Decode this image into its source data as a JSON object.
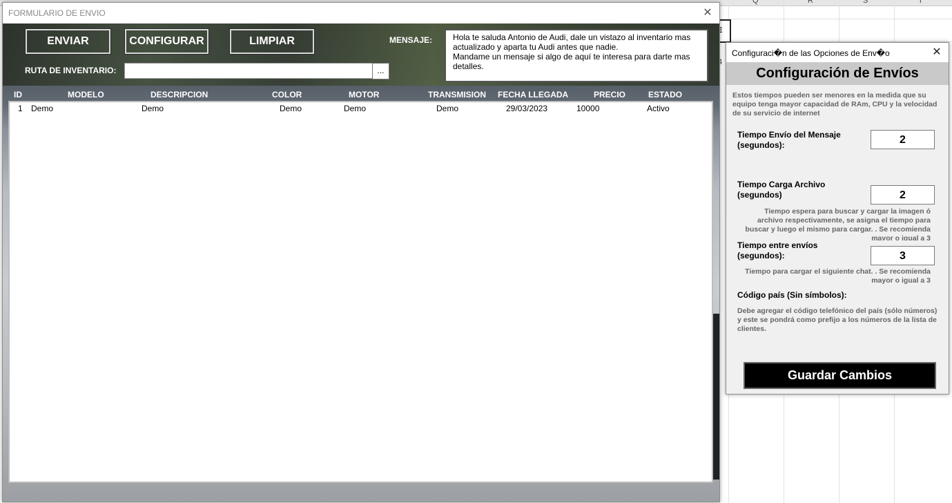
{
  "main_form": {
    "title": "FORMULARIO DE ENVIO",
    "close_glyph": "✕",
    "buttons": {
      "send": "ENVIAR",
      "configure": "CONFIGURAR",
      "clear": "LIMPIAR"
    },
    "message_label": "MENSAJE:",
    "message_text": "Hola te saluda Antonio de Audi, dale un vistazo al inventario mas actualizado y aparta tu Audi antes que nadie.\nMandame un mensaje si algo de aquí te interesa para darte mas detalles.",
    "inventory_path_label": "RUTA DE INVENTARIO:",
    "inventory_path_value": "",
    "browse_label": "...",
    "table": {
      "headers": [
        "ID",
        "MODELO",
        "DESCRIPCION",
        "COLOR",
        "MOTOR",
        "TRANSMISION",
        "FECHA LLEGADA",
        "PRECIO",
        "ESTADO"
      ],
      "rows": [
        [
          "1",
          "Demo",
          "Demo",
          "Demo",
          "Demo",
          "Demo",
          "29/03/2023",
          "10000",
          "Activo"
        ]
      ]
    }
  },
  "config_window": {
    "title": "Configuraci�n de las Opciones de Env�o",
    "close_glyph": "✕",
    "heading": "Configuración de Envíos",
    "intro_note": "Estos tiempos pueden ser menores en la medida que su equipo tenga mayor capacidad de RAm, CPU y la velocidad de su servicio de internet",
    "fields": {
      "message_time": {
        "label": "Tiempo Envío del Mensaje (segundos):",
        "value": "2"
      },
      "file_load_time": {
        "label": "Tiempo Carga Archivo (segundos)",
        "value": "2",
        "note": "Tiempo espera para buscar y cargar la imagen ó archivo respectivamente, se asigna el tiempo para buscar y luego el mismo para cargar. . Se recomienda mayor o igual a 3"
      },
      "between_sends": {
        "label": "Tiempo entre envíos (segundos):",
        "value": "3",
        "note": "Tiempo para cargar el siguiente chat. . Se recomienda mayor o igual a 3"
      },
      "country_code": {
        "label": "Código país (Sin símbolos):",
        "note": "Debe agregar el código telefónico del país (sólo números) y este se pondrá como prefijo a los números de la lista de clientes."
      }
    },
    "save_label": "Guardar Cambios"
  },
  "spreadsheet": {
    "column_letters": [
      "Q",
      "R",
      "S",
      "T"
    ],
    "cell_e_label": "E",
    "row_number": "4"
  },
  "colors": {
    "config_header_bg": "#c9c9c9",
    "save_button_bg": "#000000"
  }
}
